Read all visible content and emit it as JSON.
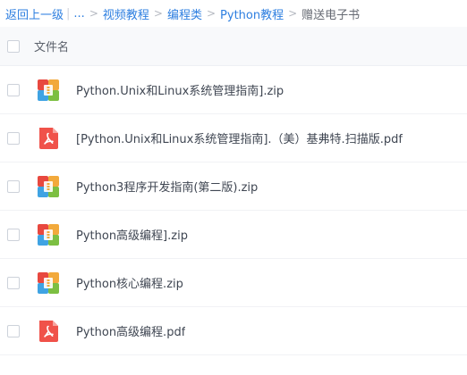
{
  "breadcrumb": {
    "back": "返回上一级",
    "ellipsis": "...",
    "items": [
      "视频教程",
      "编程类",
      "Python教程"
    ],
    "current": "赠送电子书",
    "separator": ">"
  },
  "header": {
    "name_label": "文件名"
  },
  "colors": {
    "link": "#2e7fe0",
    "zip_icon": [
      "#e8483f",
      "#f2a93b",
      "#3fa3e3",
      "#7cbf42"
    ],
    "pdf_icon": "#f0524a"
  },
  "files": [
    {
      "name": "Python.Unix和Linux系统管理指南].zip",
      "icon": "zip-archive-icon"
    },
    {
      "name": "[Python.Unix和Linux系统管理指南].（美）基弗特.扫描版.pdf",
      "icon": "pdf-icon"
    },
    {
      "name": "Python3程序开发指南(第二版).zip",
      "icon": "zip-archive-icon"
    },
    {
      "name": "Python高级编程].zip",
      "icon": "zip-archive-icon"
    },
    {
      "name": "Python核心编程.zip",
      "icon": "zip-archive-icon"
    },
    {
      "name": "Python高级编程.pdf",
      "icon": "pdf-icon"
    }
  ]
}
